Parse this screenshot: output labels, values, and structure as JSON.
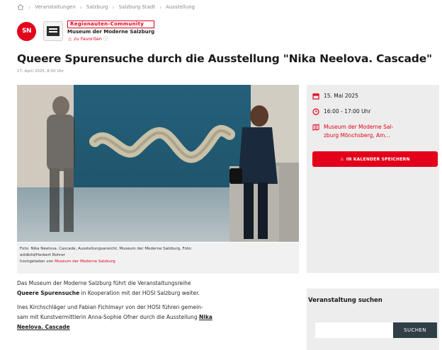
{
  "breadcrumb": {
    "items": [
      "Veranstaltungen",
      "Salzburg",
      "Salzburg Stadt",
      "Ausstellung"
    ]
  },
  "brand": {
    "logo_text": "SN",
    "community_badge": "Regionauten-Community",
    "museum_name": "Museum der Moderne Salzburg",
    "favorites_label": "zu Favoriten"
  },
  "article": {
    "title": "Queere Spurensuche durch die Ausstellung \"Nika Neelova. Cascade\"",
    "date": "17. April 2025, 8:50 Uhr",
    "caption_line1": "Foto: Nika Neelova. Cascade, Ausstellungsansicht, Museum der Moderne Salzburg, Foto:",
    "caption_line2": "wildbild/Herbert Rohrer",
    "caption_prefix": "hochgeladen von",
    "caption_link": "Museum der Moderne Salzburg",
    "p1_a": "Das Museum der Moderne Salzburg führt die Veranstaltungsreihe",
    "p1_bold": "Queere Spurensuche",
    "p1_b": "in Kooperation mit der HOSI Salzburg weiter.",
    "p2_a": "Ines Kirchschläger und Fabian Fichlmayr von der HOSI führen gemein-",
    "p2_b": "sam mit Kunstvermittlerin Anna-Sophie Ofner durch die Ausstellung",
    "p2_link1": "Nika",
    "p2_link2": "Neelova. Cascade"
  },
  "event": {
    "date": "15. Mai 2025",
    "time": "16:00 - 17:00 Uhr",
    "place_line1": "Museum der Moderne Sal-",
    "place_line2": "zburg Mönchsberg, Am...",
    "calendar_button": "IN KALENDER SPEICHERN"
  },
  "search": {
    "title": "Veranstaltung suchen",
    "placeholder": "",
    "button": "SUCHEN"
  },
  "colors": {
    "accent": "#e2001a",
    "sidebar_bg": "#ededed",
    "search_button": "#2f3e47"
  }
}
